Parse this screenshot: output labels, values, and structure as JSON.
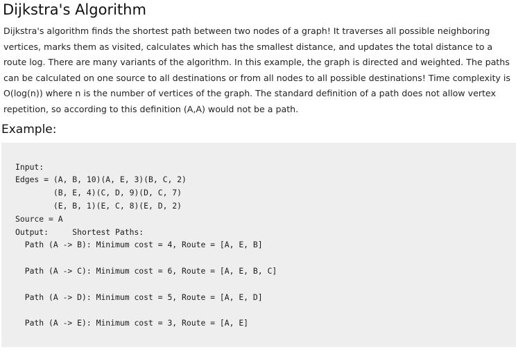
{
  "title": "Dijkstra's Algorithm",
  "description": "Dijkstra's algorithm finds the shortest path between two nodes of a graph! It traverses all possible neighboring vertices, marks them as visited, calculates which has the smallest distance, and updates the total distance to a route log. There are many variants of the algorithm. In this example, the graph is directed and weighted. The paths can be calculated on one source to all destinations or from all nodes to all possible destinations! Time complexity is O(log(n)) where n is the number of vertices of the graph. The standard definition of a path does not allow vertex repetition, so according to this definition (A,A) would not be a path.",
  "example_heading": "Example:",
  "code": {
    "input_label": "Input:",
    "edges_line_1": "Edges = (A, B, 10)(A, E, 3)(B, C, 2)",
    "edges_line_2": "        (B, E, 4)(C, D, 9)(D, C, 7)",
    "edges_line_3": "        (E, B, 1)(E, C, 8)(E, D, 2)",
    "source_line": "Source = A",
    "output_line": "Output:     Shortest Paths:",
    "paths": [
      "  Path (A -> B): Minimum cost = 4, Route = [A, E, B]",
      "  Path (A -> C): Minimum cost = 6, Route = [A, E, B, C]",
      "  Path (A -> D): Minimum cost = 5, Route = [A, E, D]",
      "  Path (A -> E): Minimum cost = 3, Route = [A, E]"
    ]
  }
}
